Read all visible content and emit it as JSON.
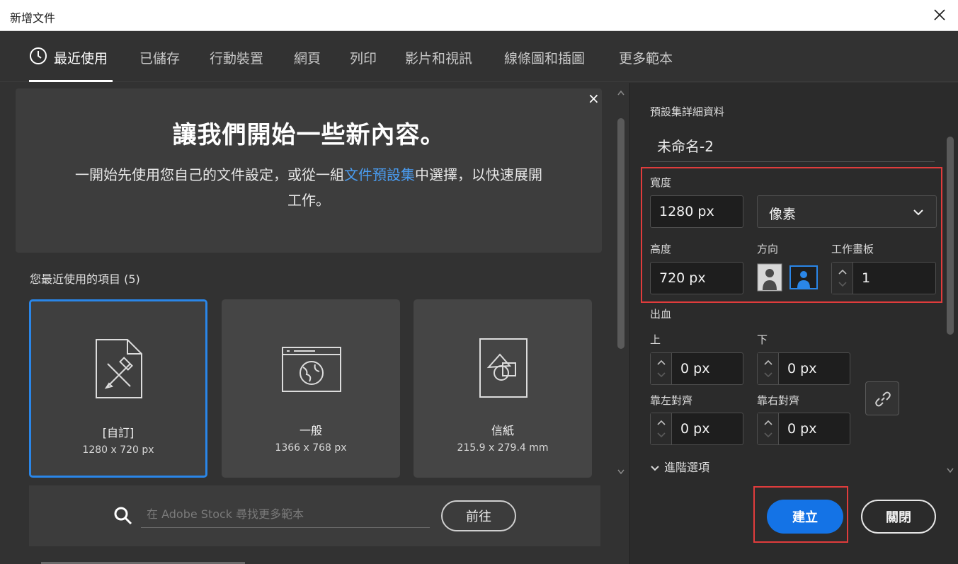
{
  "window": {
    "title": "新增文件"
  },
  "tabs": [
    {
      "label": "最近使用",
      "active": true
    },
    {
      "label": "已儲存"
    },
    {
      "label": "行動裝置"
    },
    {
      "label": "網頁"
    },
    {
      "label": "列印"
    },
    {
      "label": "影片和視訊"
    },
    {
      "label": "線條圖和插圖"
    },
    {
      "label": "更多範本"
    }
  ],
  "hero": {
    "close": "×",
    "title": "讓我們開始一些新內容。",
    "desc_before": "一開始先使用您自己的文件設定，或從一組",
    "desc_link": "文件預設集",
    "desc_after": "中選擇，以快速展開工作。"
  },
  "recent": {
    "label": "您最近使用的項目 (5)",
    "items": [
      {
        "name": "[自訂]",
        "size": "1280 x 720 px"
      },
      {
        "name": "一般",
        "size": "1366 x 768 px"
      },
      {
        "name": "信紙",
        "size": "215.9 x 279.4 mm"
      }
    ]
  },
  "stock": {
    "placeholder": "在 Adobe Stock 尋找更多範本",
    "go_label": "前往"
  },
  "preset": {
    "section_label": "預設集詳細資料",
    "doc_name": "未命名-2",
    "width_label": "寬度",
    "width_value": "1280 px",
    "unit": "像素",
    "height_label": "高度",
    "height_value": "720 px",
    "orientation_label": "方向",
    "artboards_label": "工作畫板",
    "artboards_value": "1",
    "bleed_label": "出血",
    "top_label": "上",
    "top_value": "0 px",
    "bottom_label": "下",
    "bottom_value": "0 px",
    "left_label": "靠左對齊",
    "left_value": "0 px",
    "right_label": "靠右對齊",
    "right_value": "0 px",
    "advanced_label": "進階選項"
  },
  "actions": {
    "create": "建立",
    "close": "關閉"
  },
  "colors": {
    "accent": "#1473e6",
    "highlight": "#e03c3c",
    "link": "#4a9df2"
  }
}
